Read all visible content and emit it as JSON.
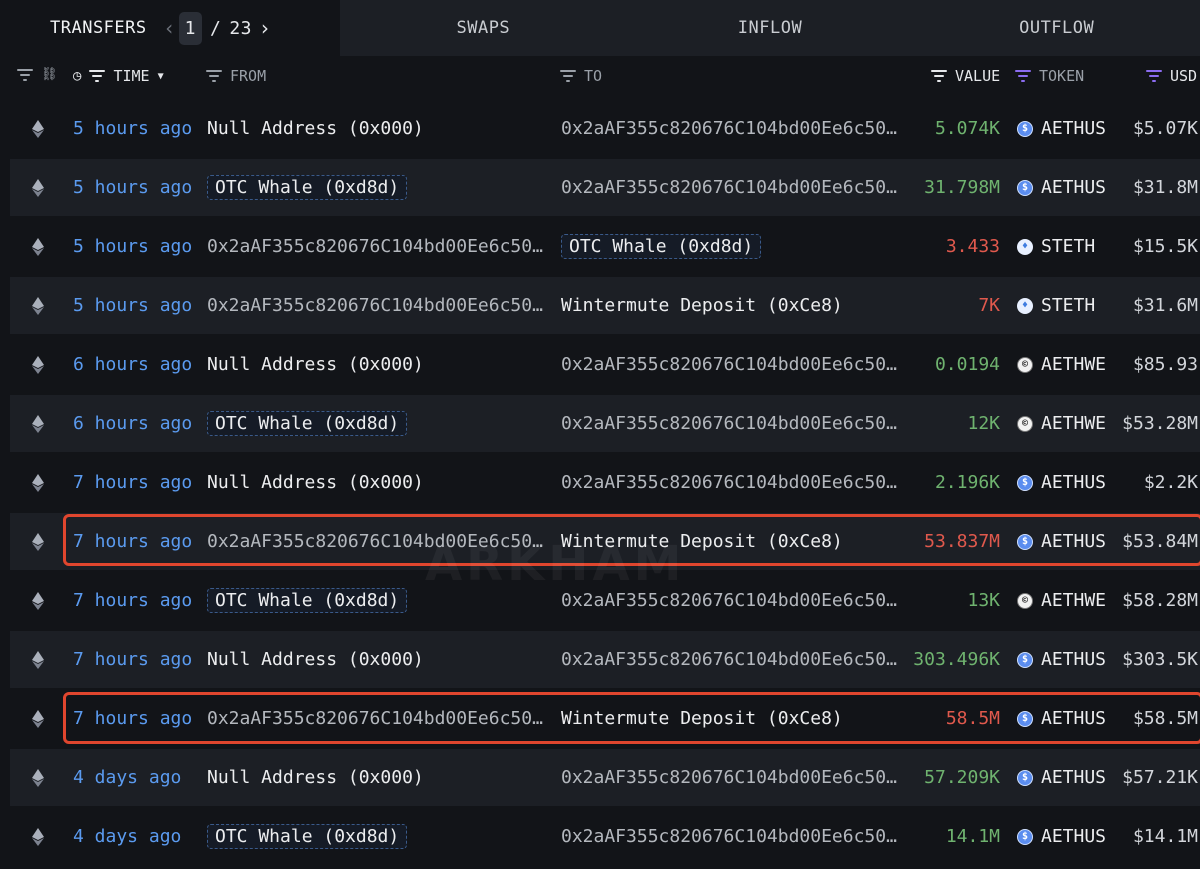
{
  "tabs": {
    "transfers": "TRANSFERS",
    "swaps": "SWAPS",
    "inflow": "INFLOW",
    "outflow": "OUTFLOW"
  },
  "pager": {
    "current": "1",
    "separator": "/",
    "total": "23"
  },
  "header": {
    "time": "TIME",
    "from": "FROM",
    "to": "TO",
    "value": "VALUE",
    "token": "TOKEN",
    "usd": "USD"
  },
  "watermark": "ARKHAM",
  "colors": {
    "accent_blue": "#5b9bf0",
    "positive": "#6fb36f",
    "negative": "#e0594d",
    "highlight": "#e0462e",
    "purple": "#8b6cf0"
  },
  "rows": [
    {
      "time": "5 hours ago",
      "from": "Null Address (0x000)",
      "to": "0x2aAF355c820676C104bd00Ee6c50…",
      "value": "5.074K",
      "token": "AETHUS",
      "usd": "$5.07K"
    },
    {
      "time": "5 hours ago",
      "from": "OTC Whale (0xd8d)",
      "to": "0x2aAF355c820676C104bd00Ee6c50…",
      "value": "31.798M",
      "token": "AETHUS",
      "usd": "$31.8M"
    },
    {
      "time": "5 hours ago",
      "from": "0x2aAF355c820676C104bd00Ee6c50…",
      "to": "OTC Whale (0xd8d)",
      "value": "3.433",
      "token": "STETH",
      "usd": "$15.5K"
    },
    {
      "time": "5 hours ago",
      "from": "0x2aAF355c820676C104bd00Ee6c50…",
      "to": "Wintermute Deposit (0xCe8)",
      "value": "7K",
      "token": "STETH",
      "usd": "$31.6M"
    },
    {
      "time": "6 hours ago",
      "from": "Null Address (0x000)",
      "to": "0x2aAF355c820676C104bd00Ee6c50…",
      "value": "0.0194",
      "token": "AETHWE",
      "usd": "$85.93"
    },
    {
      "time": "6 hours ago",
      "from": "OTC Whale (0xd8d)",
      "to": "0x2aAF355c820676C104bd00Ee6c50…",
      "value": "12K",
      "token": "AETHWE",
      "usd": "$53.28M"
    },
    {
      "time": "7 hours ago",
      "from": "Null Address (0x000)",
      "to": "0x2aAF355c820676C104bd00Ee6c50…",
      "value": "2.196K",
      "token": "AETHUS",
      "usd": "$2.2K"
    },
    {
      "time": "7 hours ago",
      "from": "0x2aAF355c820676C104bd00Ee6c50…",
      "to": "Wintermute Deposit (0xCe8)",
      "value": "53.837M",
      "token": "AETHUS",
      "usd": "$53.84M"
    },
    {
      "time": "7 hours ago",
      "from": "OTC Whale (0xd8d)",
      "to": "0x2aAF355c820676C104bd00Ee6c50…",
      "value": "13K",
      "token": "AETHWE",
      "usd": "$58.28M"
    },
    {
      "time": "7 hours ago",
      "from": "Null Address (0x000)",
      "to": "0x2aAF355c820676C104bd00Ee6c50…",
      "value": "303.496K",
      "token": "AETHUS",
      "usd": "$303.5K"
    },
    {
      "time": "7 hours ago",
      "from": "0x2aAF355c820676C104bd00Ee6c50…",
      "to": "Wintermute Deposit (0xCe8)",
      "value": "58.5M",
      "token": "AETHUS",
      "usd": "$58.5M"
    },
    {
      "time": "4 days ago",
      "from": "Null Address (0x000)",
      "to": "0x2aAF355c820676C104bd00Ee6c50…",
      "value": "57.209K",
      "token": "AETHUS",
      "usd": "$57.21K"
    },
    {
      "time": "4 days ago",
      "from": "OTC Whale (0xd8d)",
      "to": "0x2aAF355c820676C104bd00Ee6c50…",
      "value": "14.1M",
      "token": "AETHUS",
      "usd": "$14.1M"
    }
  ]
}
